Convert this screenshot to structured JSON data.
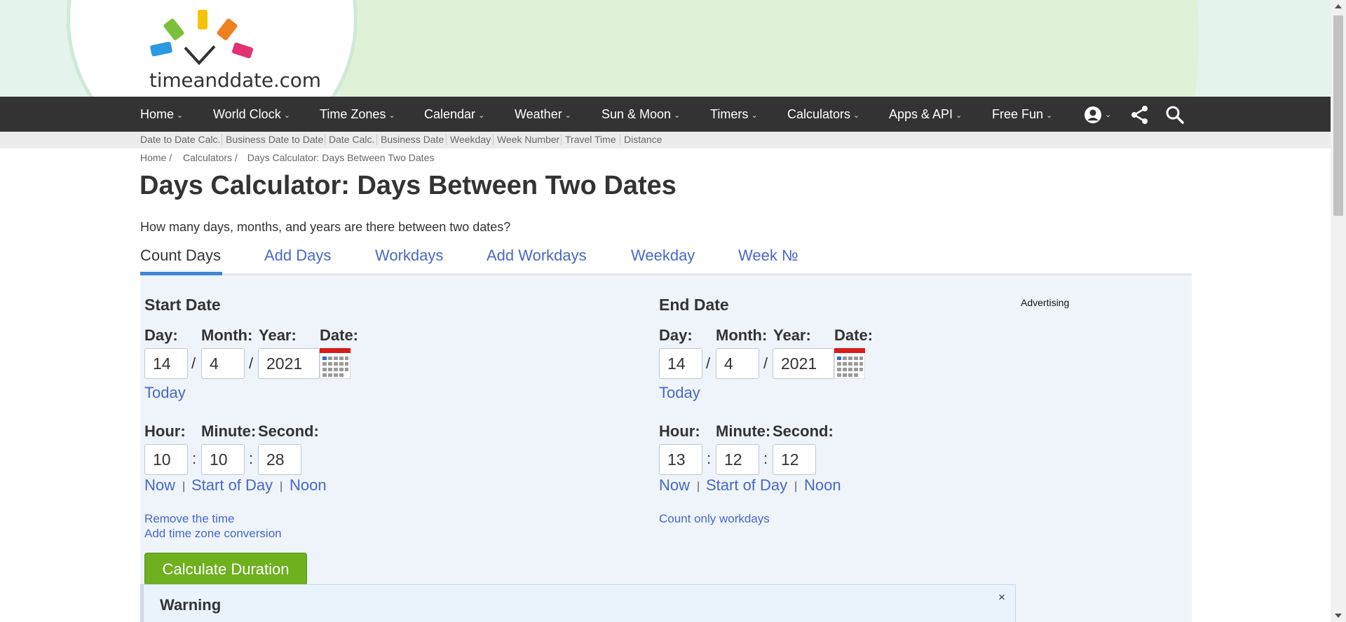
{
  "logo": {
    "text_a": "time",
    "text_b": "and",
    "text_c": "date",
    "text_d": ".com"
  },
  "nav": {
    "items": [
      "Home",
      "World Clock",
      "Time Zones",
      "Calendar",
      "Weather",
      "Sun & Moon",
      "Timers",
      "Calculators",
      "Apps & API",
      "Free Fun"
    ],
    "icons": [
      "account-icon",
      "share-icon",
      "search-icon"
    ]
  },
  "subnav": [
    "Date to Date Calc.",
    "Business Date to Date",
    "Date Calc.",
    "Business Date",
    "Weekday",
    "Week Number",
    "Travel Time",
    "Distance"
  ],
  "breadcrumb": [
    "Home /",
    "Calculators /",
    "Days Calculator: Days Between Two Dates"
  ],
  "page": {
    "title": "Days Calculator: Days Between Two Dates",
    "intro": "How many days, months, and years are there between two dates?"
  },
  "tabs": [
    "Count Days",
    "Add Days",
    "Workdays",
    "Add Workdays",
    "Weekday",
    "Week №"
  ],
  "labels": {
    "day": "Day:",
    "month": "Month:",
    "year": "Year:",
    "date": "Date:",
    "hour": "Hour:",
    "minute": "Minute:",
    "second": "Second:",
    "slash": "/",
    "colon": ":",
    "pipe": "|"
  },
  "start": {
    "title": "Start Date",
    "day": "14",
    "month": "4",
    "year": "2021",
    "today": "Today",
    "hour": "10",
    "minute": "10",
    "second": "28",
    "now": "Now",
    "start_of_day": "Start of Day",
    "noon": "Noon",
    "remove_time": "Remove the time",
    "add_tz": "Add time zone conversion"
  },
  "end": {
    "title": "End Date",
    "day": "14",
    "month": "4",
    "year": "2021",
    "today": "Today",
    "hour": "13",
    "minute": "12",
    "second": "12",
    "now": "Now",
    "start_of_day": "Start of Day",
    "noon": "Noon",
    "workdays": "Count only workdays"
  },
  "calculate": "Calculate Duration",
  "advertising": "Advertising",
  "warning": {
    "title": "Warning",
    "close": "×"
  },
  "colors": {
    "nav_bg": "#333333",
    "link": "#4b66c8",
    "button": "#6fb01f",
    "tab_accent": "#3e87d8",
    "panel_bg": "#eef4fa"
  }
}
